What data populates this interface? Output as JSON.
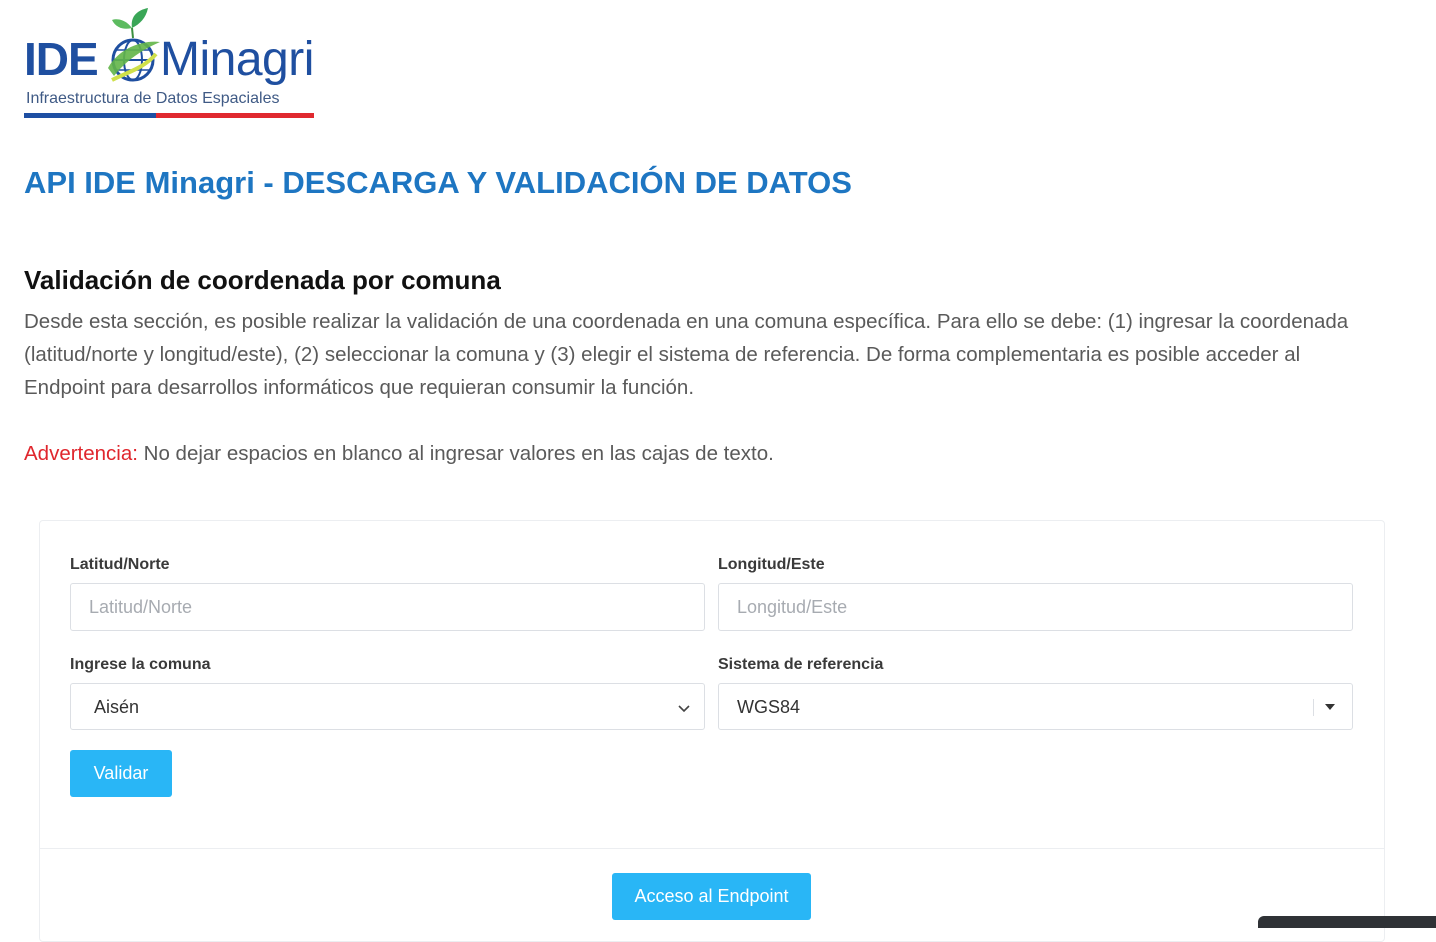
{
  "logo": {
    "brand_left": "IDE",
    "brand_right": "Minagri",
    "tagline": "Infraestructura de Datos Espaciales",
    "colors": {
      "blue": "#1f4fa0",
      "red": "#e0292f",
      "green": "#3aa657"
    }
  },
  "page": {
    "title": "API IDE Minagri - DESCARGA Y VALIDACIÓN DE DATOS"
  },
  "section": {
    "title": "Validación de coordenada por comuna",
    "description": "Desde esta sección, es posible realizar la validación de una coordenada en una comuna específica. Para ello se debe: (1) ingresar la coordenada (latitud/norte y longitud/este), (2) seleccionar la comuna y (3) elegir el sistema de referencia. De forma complementaria es posible acceder al Endpoint para desarrollos informáticos que requieran consumir la función.",
    "warning_label": "Advertencia:",
    "warning_text": " No dejar espacios en blanco al ingresar valores en las cajas de texto."
  },
  "form": {
    "latitude": {
      "label": "Latitud/Norte",
      "placeholder": "Latitud/Norte",
      "value": ""
    },
    "longitude": {
      "label": "Longitud/Este",
      "placeholder": "Longitud/Este",
      "value": ""
    },
    "comuna": {
      "label": "Ingrese la comuna",
      "selected": "Aisén",
      "icon": "chevron-down-icon"
    },
    "reference_system": {
      "label": "Sistema de referencia",
      "selected": "WGS84",
      "icon": "caret-down-icon"
    },
    "validate_button": "Validar",
    "endpoint_button": "Acceso al Endpoint",
    "button_color": "#29b6f6"
  },
  "theme": {
    "title_color": "#1e76c2",
    "warning_color": "#e0262d"
  }
}
